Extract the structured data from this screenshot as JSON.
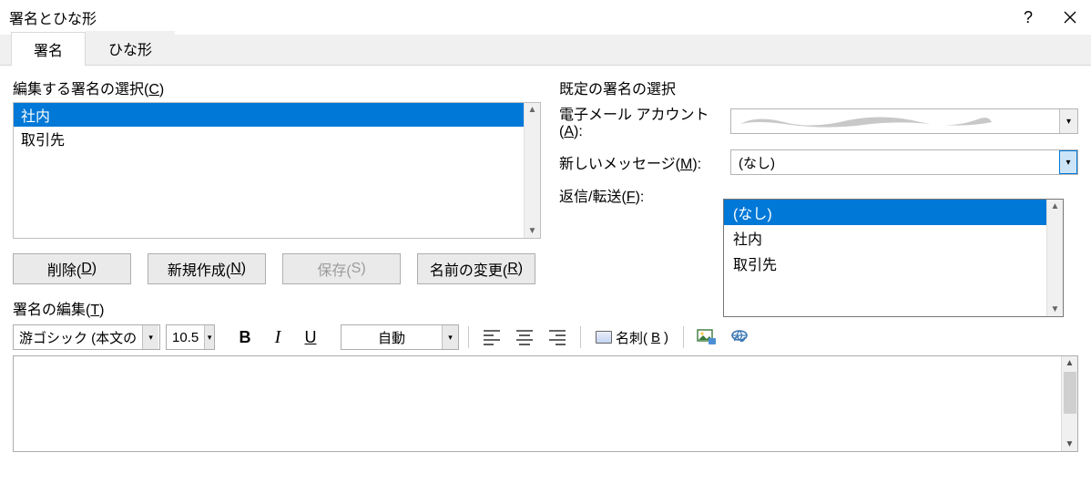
{
  "window": {
    "title": "署名とひな形"
  },
  "tabs": {
    "signatures": "署名",
    "stationery": "ひな形"
  },
  "left": {
    "group_label_pre": "編集する署名の選択(",
    "group_label_key": "C",
    "group_label_post": ")",
    "items": [
      "社内",
      "取引先"
    ],
    "buttons": {
      "delete_pre": "削除(",
      "delete_key": "D",
      "delete_post": ")",
      "new_pre": "新規作成(",
      "new_key": "N",
      "new_post": ")",
      "save_pre": "保存(",
      "save_key": "S",
      "save_post": ")",
      "rename_pre": "名前の変更(",
      "rename_key": "R",
      "rename_post": ")"
    }
  },
  "right": {
    "group_label": "既定の署名の選択",
    "account_label_pre": "電子メール アカウント(",
    "account_label_key": "A",
    "account_label_post": "):",
    "newmsg_label_pre": "新しいメッセージ(",
    "newmsg_label_key": "M",
    "newmsg_label_post": "):",
    "newmsg_value": "(なし)",
    "reply_label_pre": "返信/転送(",
    "reply_label_key": "F",
    "reply_label_post": "):",
    "dropdown_options": [
      "(なし)",
      "社内",
      "取引先"
    ]
  },
  "editor": {
    "group_label_pre": "署名の編集(",
    "group_label_key": "T",
    "group_label_post": ")",
    "font": "游ゴシック (本文の",
    "size": "10.5",
    "color": "自動",
    "bizcard_pre": "名刺(",
    "bizcard_key": "B",
    "bizcard_post": ")"
  }
}
